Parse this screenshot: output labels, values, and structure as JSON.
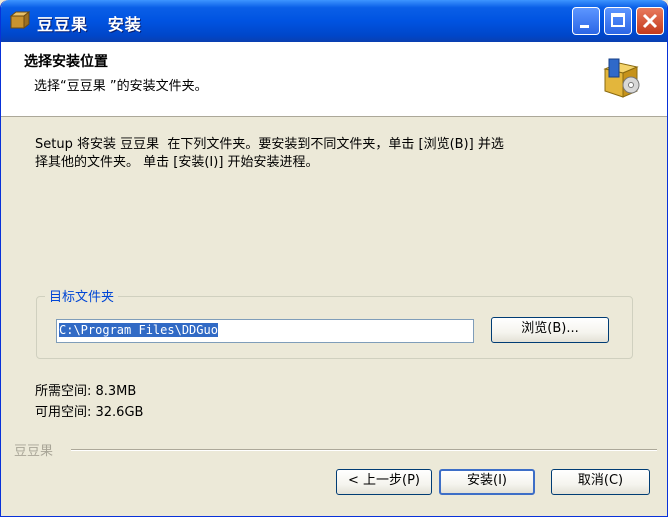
{
  "window": {
    "title": "豆豆果   安装"
  },
  "header": {
    "title": "选择安装位置",
    "subtitle": "选择“豆豆果 ”的安装文件夹。"
  },
  "intro_text": "Setup 将安装 豆豆果  在下列文件夹。要安装到不同文件夹，单击 [浏览(B)] 并选\n择其他的文件夹。 单击 [安装(I)] 开始安装进程。",
  "destination": {
    "group_label": "目标文件夹",
    "path_value": "C:\\Program Files\\DDGuo",
    "browse_label": "浏览(B)..."
  },
  "space": {
    "required": "所需空间: 8.3MB",
    "available": "可用空间: 32.6GB"
  },
  "footer": {
    "brand": "豆豆果",
    "back_label": "< 上一步(P)",
    "install_label": "安装(I)",
    "cancel_label": "取消(C)"
  },
  "colors": {
    "titlebar": "#0053e1",
    "face": "#ece9d8",
    "accent_text": "#0046d5",
    "selection": "#316ac5"
  },
  "icons": [
    "app-icon",
    "minimize-icon",
    "maximize-icon",
    "close-icon",
    "installer-box-icon"
  ]
}
